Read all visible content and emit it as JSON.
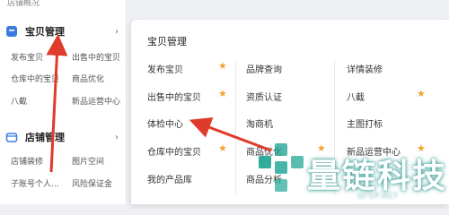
{
  "sidebar": {
    "top_partial": "店铺概况",
    "groups": [
      {
        "title": "宝贝管理",
        "icon": "box-icon",
        "items": [
          "发布宝贝",
          "出售中的宝贝",
          "仓库中的宝贝",
          "商品优化",
          "八截",
          "新品运营中心"
        ]
      },
      {
        "title": "店铺管理",
        "icon": "store-icon",
        "items": [
          "店铺装修",
          "图片空间",
          "子账号个人...",
          "风险保证金"
        ]
      }
    ]
  },
  "menu": {
    "title": "宝贝管理",
    "col1": [
      "发布宝贝",
      "出售中的宝贝",
      "体检中心",
      "仓库中的宝贝",
      "我的产品库"
    ],
    "col2": [
      "品牌查询",
      "资质认证",
      "淘商机",
      "商品优化",
      "商品分析"
    ],
    "col3": [
      "详情装修",
      "八截",
      "主图打标",
      "新品运营中心",
      ""
    ]
  },
  "watermark": {
    "text": "量链科技",
    "sub": "QFSP.NET"
  },
  "colors": {
    "accent": "#f0a331",
    "arrow": "#e03a2a",
    "watermark": "#1ea593"
  }
}
